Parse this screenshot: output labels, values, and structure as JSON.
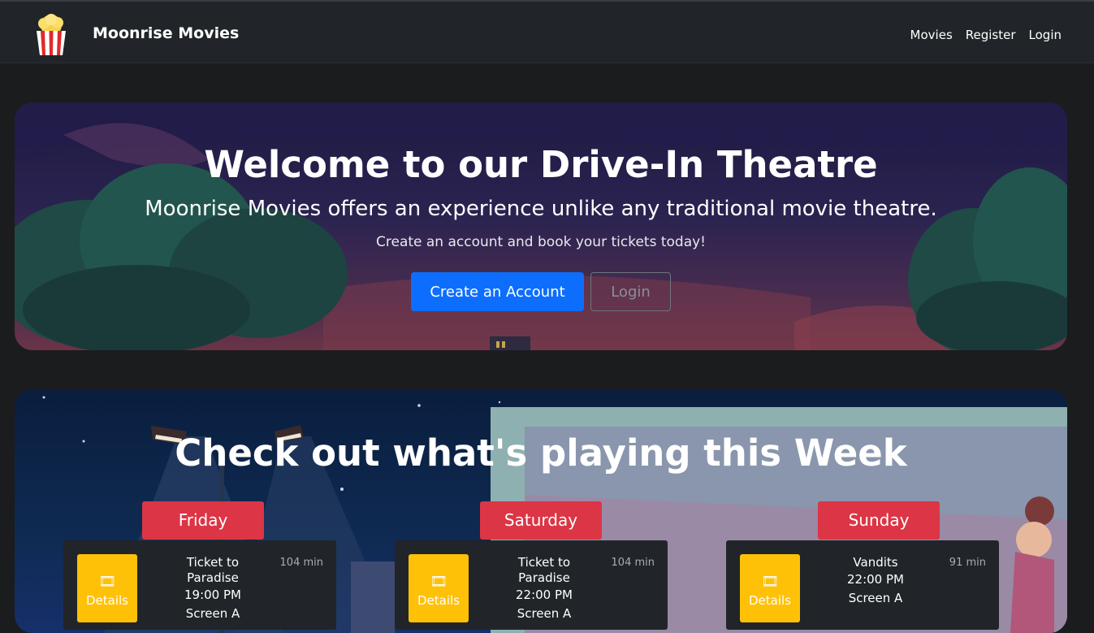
{
  "navbar": {
    "brand": "Moonrise Movies",
    "logo_icon": "popcorn-icon",
    "links": [
      "Movies",
      "Register",
      "Login"
    ]
  },
  "hero": {
    "title": "Welcome to our Drive-In Theatre",
    "subtitle": "Moonrise Movies offers an experience unlike any traditional movie theatre.",
    "tagline": "Create an account and book your tickets today!",
    "primary_button": "Create an Account",
    "secondary_button": "Login"
  },
  "schedule": {
    "title": "Check out what's playing this Week",
    "days": [
      {
        "day": "Friday",
        "showing": {
          "details_label": "Details",
          "title": "Ticket to Paradise",
          "time": "19:00 PM",
          "runtime": "104 min",
          "screen": "Screen A"
        }
      },
      {
        "day": "Saturday",
        "showing": {
          "details_label": "Details",
          "title": "Ticket to Paradise",
          "time": "22:00 PM",
          "runtime": "104 min",
          "screen": "Screen A"
        }
      },
      {
        "day": "Sunday",
        "showing": {
          "details_label": "Details",
          "title": "Vandits",
          "time": "22:00 PM",
          "runtime": "91 min",
          "screen": "Screen A"
        }
      }
    ]
  },
  "colors": {
    "navbar_bg": "#212529",
    "primary": "#0d6efd",
    "danger": "#dc3545",
    "warning": "#ffc107"
  }
}
